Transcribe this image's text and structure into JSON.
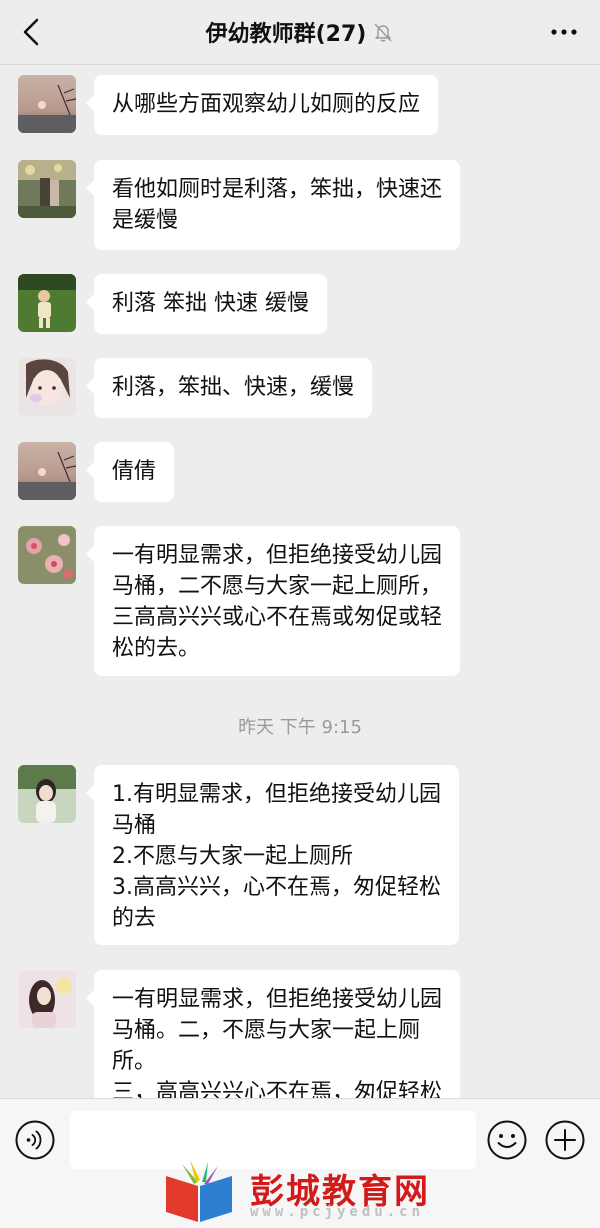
{
  "header": {
    "title": "伊幼教师群(27)"
  },
  "messages": [
    {
      "lines": [
        "从哪些方面观察幼儿如厕的反应"
      ]
    },
    {
      "lines": [
        "看他如厕时是利落，笨拙，快速还",
        "是缓慢"
      ]
    },
    {
      "lines": [
        "利落 笨拙 快速 缓慢"
      ]
    },
    {
      "lines": [
        "利落，笨拙、快速，缓慢"
      ]
    },
    {
      "lines": [
        "倩倩"
      ]
    },
    {
      "lines": [
        "一有明显需求，但拒绝接受幼儿园",
        "马桶，二不愿与大家一起上厕所，",
        "三高高兴兴或心不在焉或匆促或轻",
        "松的去。"
      ]
    },
    {
      "lines": [
        "1.有明显需求，但拒绝接受幼儿园",
        "马桶",
        "2.不愿与大家一起上厕所",
        "3.高高兴兴，心不在焉，匆促轻松",
        "的去"
      ]
    },
    {
      "lines": [
        "一有明显需求，但拒绝接受幼儿园",
        "马桶。二，不愿与大家一起上厕",
        "所。",
        "三，高高兴兴心不在焉，匆促轻松"
      ]
    }
  ],
  "timestamp": "昨天 下午 9:15",
  "input": {
    "value": ""
  },
  "watermark": {
    "text": "彭城教育网",
    "url": "www.pcjyedu.cn"
  }
}
